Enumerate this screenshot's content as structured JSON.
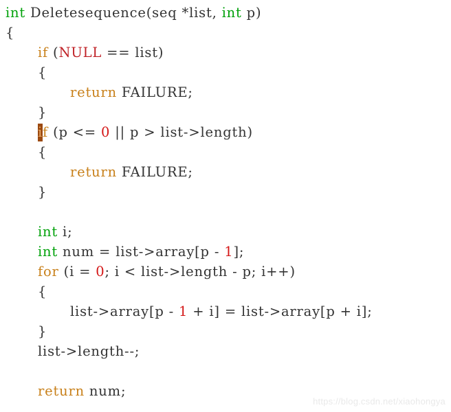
{
  "editor": {
    "language": "c",
    "background_color": "#ffffff",
    "default_text_color": "#333333",
    "syntax_colors": {
      "type": "#00a10a",
      "keyword": "#c8801a",
      "constant": "#bf2026",
      "number": "#d41616",
      "plain": "#333333",
      "cursor_highlight_bg": "#9c4a10",
      "cursor_highlight_fg": "#e8a864"
    },
    "cursor": {
      "line_index": 6,
      "character": "i",
      "token": "if"
    }
  },
  "watermark": {
    "text": "https://blog.csdn.net/xiaohongya",
    "color": "#e9e9e9"
  },
  "code": {
    "lines": [
      {
        "n": 1,
        "indent": 0,
        "text": "int Deletesequence(seq *list, int p)",
        "tokens": [
          {
            "t": "int",
            "c": "type"
          },
          {
            "t": " Deletesequence(seq *list, ",
            "c": "plain"
          },
          {
            "t": "int",
            "c": "type"
          },
          {
            "t": " p)",
            "c": "plain"
          }
        ]
      },
      {
        "n": 2,
        "indent": 0,
        "text": "{",
        "tokens": [
          {
            "t": "{",
            "c": "punct"
          }
        ]
      },
      {
        "n": 3,
        "indent": 1,
        "text": "if (NULL == list)",
        "tokens": [
          {
            "t": "if",
            "c": "kw"
          },
          {
            "t": " (",
            "c": "plain"
          },
          {
            "t": "NULL",
            "c": "const"
          },
          {
            "t": " == list)",
            "c": "plain"
          }
        ]
      },
      {
        "n": 4,
        "indent": 1,
        "text": "{",
        "tokens": [
          {
            "t": "{",
            "c": "punct"
          }
        ]
      },
      {
        "n": 5,
        "indent": 2,
        "text": "return FAILURE;",
        "tokens": [
          {
            "t": "return",
            "c": "kw"
          },
          {
            "t": " FAILURE;",
            "c": "plain"
          }
        ]
      },
      {
        "n": 6,
        "indent": 1,
        "text": "}",
        "tokens": [
          {
            "t": "}",
            "c": "punct"
          }
        ]
      },
      {
        "n": 7,
        "indent": 1,
        "text": "if (p <= 0 || p > list->length)",
        "cursor_on_first_char": true,
        "tokens": [
          {
            "t": "i",
            "c": "kw",
            "cursor": true
          },
          {
            "t": "f",
            "c": "kw"
          },
          {
            "t": " (p <= ",
            "c": "plain"
          },
          {
            "t": "0",
            "c": "num"
          },
          {
            "t": " || p > list->length)",
            "c": "plain"
          }
        ]
      },
      {
        "n": 8,
        "indent": 1,
        "text": "{",
        "tokens": [
          {
            "t": "{",
            "c": "punct"
          }
        ]
      },
      {
        "n": 9,
        "indent": 2,
        "text": "return FAILURE;",
        "tokens": [
          {
            "t": "return",
            "c": "kw"
          },
          {
            "t": " FAILURE;",
            "c": "plain"
          }
        ]
      },
      {
        "n": 10,
        "indent": 1,
        "text": "}",
        "tokens": [
          {
            "t": "}",
            "c": "punct"
          }
        ]
      },
      {
        "n": 11,
        "indent": 0,
        "text": "",
        "tokens": []
      },
      {
        "n": 12,
        "indent": 1,
        "text": "int i;",
        "tokens": [
          {
            "t": "int",
            "c": "type"
          },
          {
            "t": " i;",
            "c": "plain"
          }
        ]
      },
      {
        "n": 13,
        "indent": 1,
        "text": "int num = list->array[p - 1];",
        "tokens": [
          {
            "t": "int",
            "c": "type"
          },
          {
            "t": " num = list->array[p - ",
            "c": "plain"
          },
          {
            "t": "1",
            "c": "num"
          },
          {
            "t": "];",
            "c": "plain"
          }
        ]
      },
      {
        "n": 14,
        "indent": 1,
        "text": "for (i = 0; i < list->length - p; i++)",
        "tokens": [
          {
            "t": "for",
            "c": "kw"
          },
          {
            "t": " (i = ",
            "c": "plain"
          },
          {
            "t": "0",
            "c": "num"
          },
          {
            "t": "; i < list->length - p; i++)",
            "c": "plain"
          }
        ]
      },
      {
        "n": 15,
        "indent": 1,
        "text": "{",
        "tokens": [
          {
            "t": "{",
            "c": "punct"
          }
        ]
      },
      {
        "n": 16,
        "indent": 2,
        "text": "list->array[p - 1 + i] = list->array[p + i];",
        "tokens": [
          {
            "t": "list->array[p - ",
            "c": "plain"
          },
          {
            "t": "1",
            "c": "num"
          },
          {
            "t": " + i] = list->array[p + i];",
            "c": "plain"
          }
        ]
      },
      {
        "n": 17,
        "indent": 1,
        "text": "}",
        "tokens": [
          {
            "t": "}",
            "c": "punct"
          }
        ]
      },
      {
        "n": 18,
        "indent": 1,
        "text": "list->length--;",
        "tokens": [
          {
            "t": "list->length--;",
            "c": "plain"
          }
        ]
      },
      {
        "n": 19,
        "indent": 0,
        "text": "",
        "tokens": []
      },
      {
        "n": 20,
        "indent": 1,
        "text": "return num;",
        "tokens": [
          {
            "t": "return",
            "c": "kw"
          },
          {
            "t": " num;",
            "c": "plain"
          }
        ]
      }
    ]
  }
}
